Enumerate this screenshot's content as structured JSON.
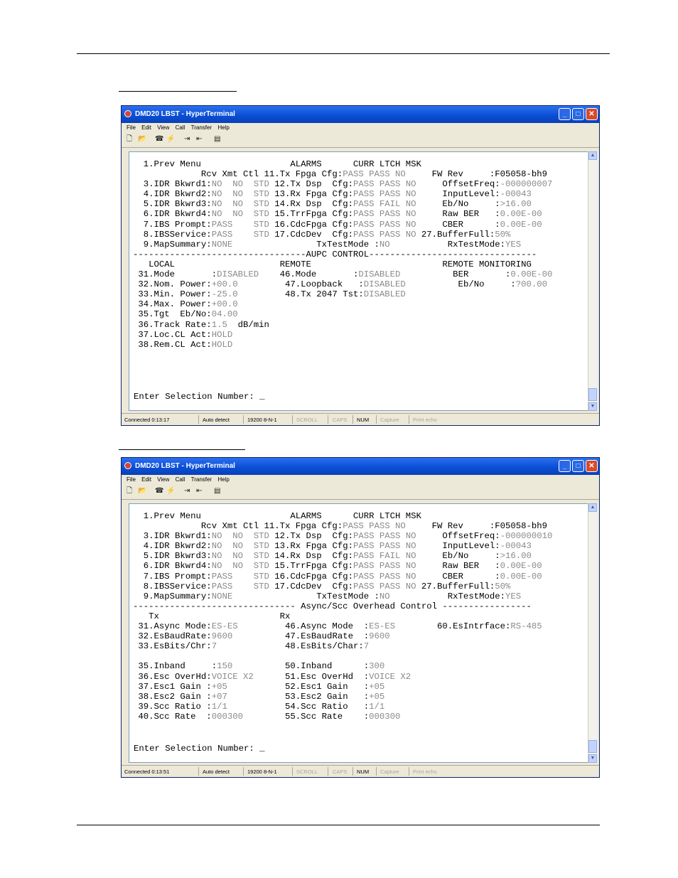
{
  "window1": {
    "title": "DMD20 LBST - HyperTerminal",
    "menu": [
      "File",
      "Edit",
      "View",
      "Call",
      "Transfer",
      "Help"
    ],
    "terminal_lines": [
      [
        {
          "t": "  1.Prev Menu                 ALARMS      CURR LTCH MSK"
        }
      ],
      [
        {
          "t": "             Rcv Xmt Ctl 11.Tx Fpga Cfg:"
        },
        {
          "t": "PASS PASS NO",
          "g": true
        },
        {
          "t": "     FW Rev     :F05058-bh9"
        }
      ],
      [
        {
          "t": "  3.IDR Bkwrd1:"
        },
        {
          "t": "NO  NO  STD",
          "g": true
        },
        {
          "t": " 12.Tx Dsp  Cfg:"
        },
        {
          "t": "PASS PASS NO",
          "g": true
        },
        {
          "t": "     OffsetFreq:"
        },
        {
          "t": "-000000007",
          "g": true
        }
      ],
      [
        {
          "t": "  4.IDR Bkwrd2:"
        },
        {
          "t": "NO  NO  STD",
          "g": true
        },
        {
          "t": " 13.Rx Fpga Cfg:"
        },
        {
          "t": "PASS PASS NO",
          "g": true
        },
        {
          "t": "     InputLevel:"
        },
        {
          "t": "-00043",
          "g": true
        }
      ],
      [
        {
          "t": "  5.IDR Bkwrd3:"
        },
        {
          "t": "NO  NO  STD",
          "g": true
        },
        {
          "t": " 14.Rx Dsp  Cfg:"
        },
        {
          "t": "PASS FAIL NO",
          "g": true
        },
        {
          "t": "     Eb/No     :"
        },
        {
          "t": ">16.00",
          "g": true
        }
      ],
      [
        {
          "t": "  6.IDR Bkwrd4:"
        },
        {
          "t": "NO  NO  STD",
          "g": true
        },
        {
          "t": " 15.TrrFpga Cfg:"
        },
        {
          "t": "PASS PASS NO",
          "g": true
        },
        {
          "t": "     Raw BER   :"
        },
        {
          "t": "0.00E-00",
          "g": true
        }
      ],
      [
        {
          "t": "  7.IBS Prompt:"
        },
        {
          "t": "PASS    STD",
          "g": true
        },
        {
          "t": " 16.CdcFpga Cfg:"
        },
        {
          "t": "PASS PASS NO",
          "g": true
        },
        {
          "t": "     CBER      :"
        },
        {
          "t": "0.00E-00",
          "g": true
        }
      ],
      [
        {
          "t": "  8.IBSService:"
        },
        {
          "t": "PASS    STD",
          "g": true
        },
        {
          "t": " 17.CdcDev  Cfg:"
        },
        {
          "t": "PASS PASS NO",
          "g": true
        },
        {
          "t": " 27.BufferFull:"
        },
        {
          "t": "50%",
          "g": true
        }
      ],
      [
        {
          "t": "  9.MapSummary:"
        },
        {
          "t": "NONE",
          "g": true
        },
        {
          "t": "                TxTestMode :"
        },
        {
          "t": "NO",
          "g": true
        },
        {
          "t": "           RxTestMode:"
        },
        {
          "t": "YES",
          "g": true
        }
      ],
      [
        {
          "t": "---------------------------------AUPC CONTROL--------------------------------"
        }
      ],
      [
        {
          "t": "   LOCAL                    REMOTE                         REMOTE MONITORING"
        }
      ],
      [
        {
          "t": " 31.Mode       :"
        },
        {
          "t": "DISABLED",
          "g": true
        },
        {
          "t": "    46.Mode       :"
        },
        {
          "t": "DISABLED",
          "g": true
        },
        {
          "t": "          BER       :"
        },
        {
          "t": "0.00E-00",
          "g": true
        }
      ],
      [
        {
          "t": " 32.Nom. Power:"
        },
        {
          "t": "+00.0",
          "g": true
        },
        {
          "t": "         47.Loopback   :"
        },
        {
          "t": "DISABLED",
          "g": true
        },
        {
          "t": "          Eb/No     :"
        },
        {
          "t": "?00.00",
          "g": true
        }
      ],
      [
        {
          "t": " 33.Min. Power:"
        },
        {
          "t": "-25.0",
          "g": true
        },
        {
          "t": "         48.Tx 2047 Tst:"
        },
        {
          "t": "DISABLED",
          "g": true
        }
      ],
      [
        {
          "t": " 34.Max. Power:"
        },
        {
          "t": "+00.0",
          "g": true
        }
      ],
      [
        {
          "t": " 35.Tgt  Eb/No:"
        },
        {
          "t": "04.00",
          "g": true
        }
      ],
      [
        {
          "t": " 36.Track Rate:"
        },
        {
          "t": "1.5",
          "g": true
        },
        {
          "t": "  dB/min"
        }
      ],
      [
        {
          "t": " 37.Loc.CL Act:"
        },
        {
          "t": "HOLD",
          "g": true
        }
      ],
      [
        {
          "t": " 38.Rem.CL Act:"
        },
        {
          "t": "HOLD",
          "g": true
        }
      ]
    ],
    "prompt": "Enter Selection Number: _",
    "status": {
      "connected": "Connected 0:13:17",
      "detect": "Auto detect",
      "settings": "19200 8-N-1",
      "scroll": "SCROLL",
      "caps": "CAPS",
      "num": "NUM",
      "capture": "Capture",
      "print": "Print echo"
    }
  },
  "window2": {
    "title": "DMD20 LBST - HyperTerminal",
    "menu": [
      "File",
      "Edit",
      "View",
      "Call",
      "Transfer",
      "Help"
    ],
    "terminal_lines": [
      [
        {
          "t": "  1.Prev Menu                 ALARMS      CURR LTCH MSK"
        }
      ],
      [
        {
          "t": "             Rcv Xmt Ctl 11.Tx Fpga Cfg:"
        },
        {
          "t": "PASS PASS NO",
          "g": true
        },
        {
          "t": "     FW Rev     :F05058-bh9"
        }
      ],
      [
        {
          "t": "  3.IDR Bkwrd1:"
        },
        {
          "t": "NO  NO  STD",
          "g": true
        },
        {
          "t": " 12.Tx Dsp  Cfg:"
        },
        {
          "t": "PASS PASS NO",
          "g": true
        },
        {
          "t": "     OffsetFreq:"
        },
        {
          "t": "-000000010",
          "g": true
        }
      ],
      [
        {
          "t": "  4.IDR Bkwrd2:"
        },
        {
          "t": "NO  NO  STD",
          "g": true
        },
        {
          "t": " 13.Rx Fpga Cfg:"
        },
        {
          "t": "PASS PASS NO",
          "g": true
        },
        {
          "t": "     InputLevel:"
        },
        {
          "t": "-00043",
          "g": true
        }
      ],
      [
        {
          "t": "  5.IDR Bkwrd3:"
        },
        {
          "t": "NO  NO  STD",
          "g": true
        },
        {
          "t": " 14.Rx Dsp  Cfg:"
        },
        {
          "t": "PASS FAIL NO",
          "g": true
        },
        {
          "t": "     Eb/No     :"
        },
        {
          "t": ">16.00",
          "g": true
        }
      ],
      [
        {
          "t": "  6.IDR Bkwrd4:"
        },
        {
          "t": "NO  NO  STD",
          "g": true
        },
        {
          "t": " 15.TrrFpga Cfg:"
        },
        {
          "t": "PASS PASS NO",
          "g": true
        },
        {
          "t": "     Raw BER   :"
        },
        {
          "t": "0.00E-00",
          "g": true
        }
      ],
      [
        {
          "t": "  7.IBS Prompt:"
        },
        {
          "t": "PASS    STD",
          "g": true
        },
        {
          "t": " 16.CdcFpga Cfg:"
        },
        {
          "t": "PASS PASS NO",
          "g": true
        },
        {
          "t": "     CBER      :"
        },
        {
          "t": "0.00E-00",
          "g": true
        }
      ],
      [
        {
          "t": "  8.IBSService:"
        },
        {
          "t": "PASS    STD",
          "g": true
        },
        {
          "t": " 17.CdcDev  Cfg:"
        },
        {
          "t": "PASS PASS NO",
          "g": true
        },
        {
          "t": " 27.BufferFull:"
        },
        {
          "t": "50%",
          "g": true
        }
      ],
      [
        {
          "t": "  9.MapSummary:"
        },
        {
          "t": "NONE",
          "g": true
        },
        {
          "t": "                TxTestMode :"
        },
        {
          "t": "NO",
          "g": true
        },
        {
          "t": "           RxTestMode:"
        },
        {
          "t": "YES",
          "g": true
        }
      ],
      [
        {
          "t": "------------------------------- Async/Scc Overhead Control -----------------"
        }
      ],
      [
        {
          "t": "   Tx                       Rx"
        }
      ],
      [
        {
          "t": " 31.Async Mode:"
        },
        {
          "t": "ES-ES",
          "g": true
        },
        {
          "t": "         46.Async Mode  :"
        },
        {
          "t": "ES-ES",
          "g": true
        },
        {
          "t": "        60.EsIntrface:"
        },
        {
          "t": "RS-485",
          "g": true
        }
      ],
      [
        {
          "t": " 32.EsBaudRate:"
        },
        {
          "t": "9600",
          "g": true
        },
        {
          "t": "          47.EsBaudRate  :"
        },
        {
          "t": "9600",
          "g": true
        }
      ],
      [
        {
          "t": " 33.EsBits/Chr:"
        },
        {
          "t": "7",
          "g": true
        },
        {
          "t": "             48.EsBits/Char:"
        },
        {
          "t": "7",
          "g": true
        }
      ],
      [
        {
          "t": ""
        }
      ],
      [
        {
          "t": " 35.Inband     :"
        },
        {
          "t": "150",
          "g": true
        },
        {
          "t": "          50.Inband      :"
        },
        {
          "t": "300",
          "g": true
        }
      ],
      [
        {
          "t": " 36.Esc OverHd:"
        },
        {
          "t": "VOICE X2",
          "g": true
        },
        {
          "t": "      51.Esc OverHd  :"
        },
        {
          "t": "VOICE X2",
          "g": true
        }
      ],
      [
        {
          "t": " 37.Esc1 Gain :"
        },
        {
          "t": "+05",
          "g": true
        },
        {
          "t": "           52.Esc1 Gain   :"
        },
        {
          "t": "+05",
          "g": true
        }
      ],
      [
        {
          "t": " 38.Esc2 Gain :"
        },
        {
          "t": "+07",
          "g": true
        },
        {
          "t": "           53.Esc2 Gain   :"
        },
        {
          "t": "+05",
          "g": true
        }
      ],
      [
        {
          "t": " 39.Scc Ratio :"
        },
        {
          "t": "1/1",
          "g": true
        },
        {
          "t": "           54.Scc Ratio   :"
        },
        {
          "t": "1/1",
          "g": true
        }
      ],
      [
        {
          "t": " 40.Scc Rate  :"
        },
        {
          "t": "000300",
          "g": true
        },
        {
          "t": "        55.Scc Rate    :"
        },
        {
          "t": "000300",
          "g": true
        }
      ]
    ],
    "prompt": "Enter Selection Number: _",
    "status": {
      "connected": "Connected 0:13:51",
      "detect": "Auto detect",
      "settings": "19200 8-N-1",
      "scroll": "SCROLL",
      "caps": "CAPS",
      "num": "NUM",
      "capture": "Capture",
      "print": "Print echo"
    }
  }
}
